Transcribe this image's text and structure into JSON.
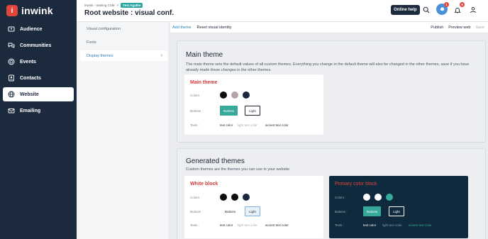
{
  "app": {
    "logo_letter": "i",
    "name": "inwink"
  },
  "sidebar": {
    "items": [
      {
        "label": "Audience",
        "icon": "id-card-icon"
      },
      {
        "label": "Communities",
        "icon": "chat-bubbles-icon"
      },
      {
        "label": "Events",
        "icon": "target-icon"
      },
      {
        "label": "Contacts",
        "icon": "contact-card-icon"
      },
      {
        "label": "Website",
        "icon": "globe-icon",
        "active": true
      },
      {
        "label": "Emailing",
        "icon": "envelope-icon"
      }
    ]
  },
  "header": {
    "breadcrumb": [
      "inwink - training CSM",
      "Test Agathe"
    ],
    "breadcrumb_sep": ">",
    "title": "Root website : visual conf.",
    "online_help": "Online help",
    "apps_badge": "1",
    "notif_badge": "9"
  },
  "subnav": {
    "items": [
      {
        "label": "Visual configuration"
      },
      {
        "label": "Fonts"
      },
      {
        "label": "Display themes",
        "active": true
      }
    ]
  },
  "toolbar": {
    "add_theme": "Add theme",
    "reset_identity": "Reset visual identity",
    "publish": "Publish",
    "preview_web": "Preview web",
    "save": "Save"
  },
  "main_theme": {
    "heading": "Main theme",
    "description": "The main theme sets the default values of all custom themes. Everything you change in the default theme will also be changed in the other themes, save if you have already made these changes in the other themes.",
    "card": {
      "title": "Main theme",
      "colors_label": "Colors :",
      "buttons_label": "Buttons :",
      "texts_label": "Texts :",
      "swatches": [
        "#0d0d0d",
        "#b5a4a6",
        "#16283a"
      ],
      "button_primary": "Buttons",
      "button_light": "Light",
      "text_color": "text color",
      "light_text_color": "light text color",
      "accent_text_color": "accent text color"
    }
  },
  "generated_themes": {
    "heading": "Generated themes",
    "description": "Custom themes are the themes you can use in your website",
    "white_block": {
      "title": "White block",
      "colors_label": "Colors :",
      "buttons_label": "Buttons :",
      "texts_label": "Texts :",
      "swatches": [
        "#0d0d0d",
        "#0d0d0d",
        "#16283a"
      ],
      "button_primary": "Buttons",
      "button_light": "Light",
      "text_color": "text color",
      "light_text_color": "light text color",
      "accent_text_color": "accent text color"
    },
    "primary_block": {
      "title": "Primary color block",
      "colors_label": "Colors :",
      "buttons_label": "Buttons :",
      "texts_label": "Texts :",
      "swatches": [
        "#ffffff",
        "#ffffff",
        "#36a99a"
      ],
      "button_primary": "Buttons",
      "button_light": "Light",
      "text_color": "text color",
      "light_text_color": "light text color",
      "accent_text_color": "accent text color"
    }
  },
  "colors": {
    "sidebar_bg": "#1c2a3e",
    "accent_teal": "#36a99a",
    "brand_red": "#e2453c",
    "link_blue": "#2b7fb6"
  }
}
